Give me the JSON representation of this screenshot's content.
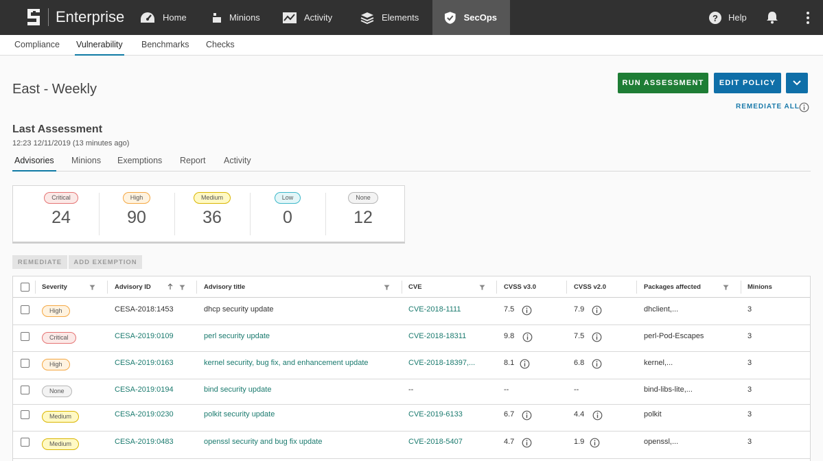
{
  "app": {
    "brand_name": "Enterprise",
    "nav": [
      {
        "label": "Home",
        "icon": "dashboard-icon"
      },
      {
        "label": "Minions",
        "icon": "minions-icon"
      },
      {
        "label": "Activity",
        "icon": "activity-icon"
      },
      {
        "label": "Elements",
        "icon": "layers-icon"
      },
      {
        "label": "SecOps",
        "icon": "shield-icon",
        "active": true
      }
    ],
    "help_label": "Help"
  },
  "subnav": [
    "Compliance",
    "Vulnerability",
    "Benchmarks",
    "Checks"
  ],
  "subnav_active": "Vulnerability",
  "page": {
    "title": "East - Weekly",
    "run_label": "RUN ASSESSMENT",
    "edit_label": "EDIT POLICY",
    "remediate_all_label": "REMEDIATE ALL",
    "last_assessment_title": "Last Assessment",
    "last_assessment_time": "12:23 12/11/2019 (13 minutes ago)"
  },
  "tabs": [
    "Advisories",
    "Minions",
    "Exemptions",
    "Report",
    "Activity"
  ],
  "tabs_active": "Advisories",
  "summary": [
    {
      "label": "Critical",
      "count": "24",
      "level": "critical"
    },
    {
      "label": "High",
      "count": "90",
      "level": "high"
    },
    {
      "label": "Medium",
      "count": "36",
      "level": "medium"
    },
    {
      "label": "Low",
      "count": "0",
      "level": "low"
    },
    {
      "label": "None",
      "count": "12",
      "level": "none"
    }
  ],
  "actions": {
    "remediate_label": "REMEDIATE",
    "add_exemption_label": "ADD EXEMPTION"
  },
  "table": {
    "headers": {
      "severity": "Severity",
      "advisory_id": "Advisory ID",
      "advisory_title": "Advisory title",
      "cve": "CVE",
      "cvss3": "CVSS v3.0",
      "cvss2": "CVSS v2.0",
      "packages": "Packages affected",
      "minions": "Minions"
    },
    "rows": [
      {
        "severity": "High",
        "level": "high",
        "advisory_id": "CESA-2018:1453",
        "id_link": false,
        "title": "dhcp security update",
        "cve": "CVE-2018-1111",
        "cvss3": "7.5",
        "cvss2": "7.9",
        "packages": "dhclient,...",
        "minions": "3"
      },
      {
        "severity": "Critical",
        "level": "critical",
        "advisory_id": "CESA-2019:0109",
        "id_link": true,
        "title": "perl security update",
        "cve": "CVE-2018-18311",
        "cvss3": "9.8",
        "cvss2": "7.5",
        "packages": "perl-Pod-Escapes",
        "minions": "3"
      },
      {
        "severity": "High",
        "level": "high",
        "advisory_id": "CESA-2019:0163",
        "id_link": true,
        "title": "kernel security, bug fix, and enhancement update",
        "cve": "CVE-2018-18397,...",
        "cvss3": "8.1",
        "cvss2": "6.8",
        "packages": "kernel,...",
        "minions": "3"
      },
      {
        "severity": "None",
        "level": "none",
        "advisory_id": "CESA-2019:0194",
        "id_link": true,
        "title": "bind security update",
        "cve": "--",
        "cvss3": "--",
        "cvss2": "--",
        "packages": "bind-libs-lite,...",
        "minions": "3"
      },
      {
        "severity": "Medium",
        "level": "medium",
        "advisory_id": "CESA-2019:0230",
        "id_link": true,
        "title": "polkit security update",
        "cve": "CVE-2019-6133",
        "cvss3": "6.7",
        "cvss2": "4.4",
        "packages": "polkit",
        "minions": "3"
      },
      {
        "severity": "Medium",
        "level": "medium",
        "advisory_id": "CESA-2019:0483",
        "id_link": true,
        "title": "openssl security and bug fix update",
        "cve": "CVE-2018-5407",
        "cvss3": "4.7",
        "cvss2": "1.9",
        "packages": "openssl,...",
        "minions": "3"
      }
    ]
  },
  "colors": {
    "topbar": "#313131",
    "run_button": "#1e7d35",
    "edit_button": "#0f6fa8",
    "link": "#1a7a6e",
    "tab_underline": "#0f7aa5"
  }
}
